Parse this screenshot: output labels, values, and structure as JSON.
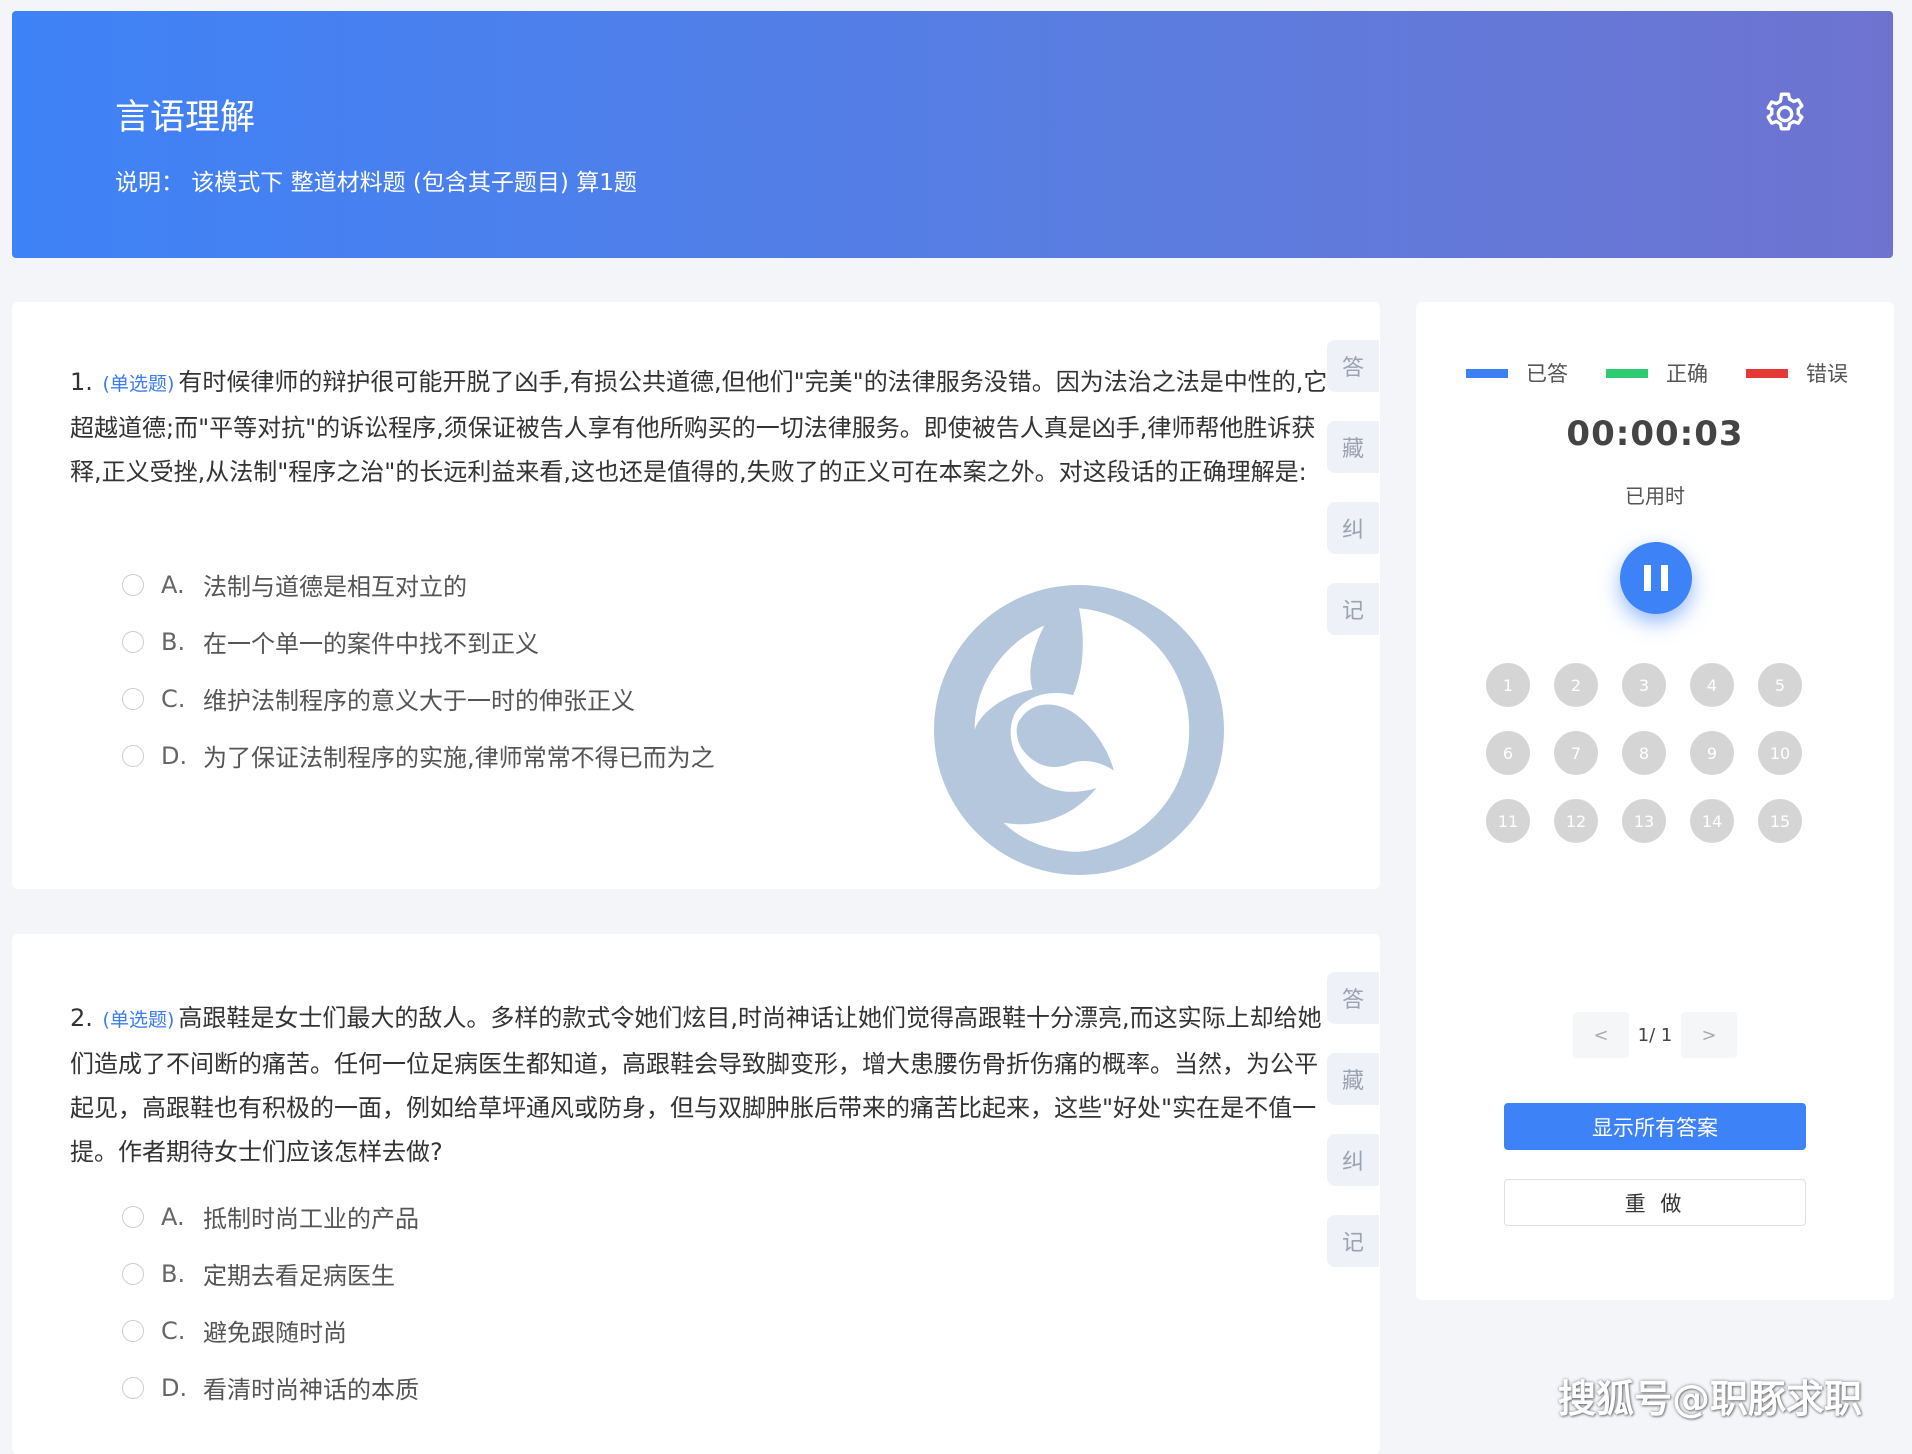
{
  "header": {
    "title": "言语理解",
    "description": "说明： 该模式下 整道材料题 (包含其子题目) 算1题",
    "settings_icon": "gear-icon"
  },
  "side_tabs": [
    "答",
    "藏",
    "纠",
    "记"
  ],
  "questions": [
    {
      "number": "1.",
      "type": "(单选题)",
      "text": "有时候律师的辩护很可能开脱了凶手,有损公共道德,但他们\"完美\"的法律服务没错。因为法治之法是中性的,它超越道德;而\"平等对抗\"的诉讼程序,须保证被告人享有他所购买的一切法律服务。即使被告人真是凶手,律师帮他胜诉获释,正义受挫,从法制\"程序之治\"的长远利益来看,这也还是值得的,失败了的正义可在本案之外。对这段话的正确理解是:",
      "options": [
        {
          "letter": "A.",
          "text": "法制与道德是相互对立的"
        },
        {
          "letter": "B.",
          "text": "在一个单一的案件中找不到正义"
        },
        {
          "letter": "C.",
          "text": "维护法制程序的意义大于一时的伸张正义"
        },
        {
          "letter": "D.",
          "text": "为了保证法制程序的实施,律师常常不得已而为之"
        }
      ]
    },
    {
      "number": "2.",
      "type": "(单选题)",
      "text": "高跟鞋是女士们最大的敌人。多样的款式令她们炫目,时尚神话让她们觉得高跟鞋十分漂亮,而这实际上却给她们造成了不间断的痛苦。任何一位足病医生都知道，高跟鞋会导致脚变形，增大患腰伤骨折伤痛的概率。当然，为公平起见，高跟鞋也有积极的一面，例如给草坪通风或防身，但与双脚肿胀后带来的痛苦比起来，这些\"好处\"实在是不值一提。作者期待女士们应该怎样去做?",
      "options": [
        {
          "letter": "A.",
          "text": "抵制时尚工业的产品"
        },
        {
          "letter": "B.",
          "text": "定期去看足病医生"
        },
        {
          "letter": "C.",
          "text": "避免跟随时尚"
        },
        {
          "letter": "D.",
          "text": "看清时尚神话的本质"
        }
      ]
    }
  ],
  "panel": {
    "legend": [
      {
        "label": "已答",
        "color": "#3d7ff5"
      },
      {
        "label": "正确",
        "color": "#2ecc71"
      },
      {
        "label": "错误",
        "color": "#e53935"
      }
    ],
    "timer": "00:00:03",
    "timer_label": "已用时",
    "pause_icon": "pause-icon",
    "question_numbers": [
      "1",
      "2",
      "3",
      "4",
      "5",
      "6",
      "7",
      "8",
      "9",
      "10",
      "11",
      "12",
      "13",
      "14",
      "15"
    ],
    "pager": {
      "prev": "<",
      "info": "1/ 1",
      "next": ">"
    },
    "show_answers_label": "显示所有答案",
    "redo_label": "重 做"
  },
  "corner_watermark": "搜狐号@职豚求职"
}
